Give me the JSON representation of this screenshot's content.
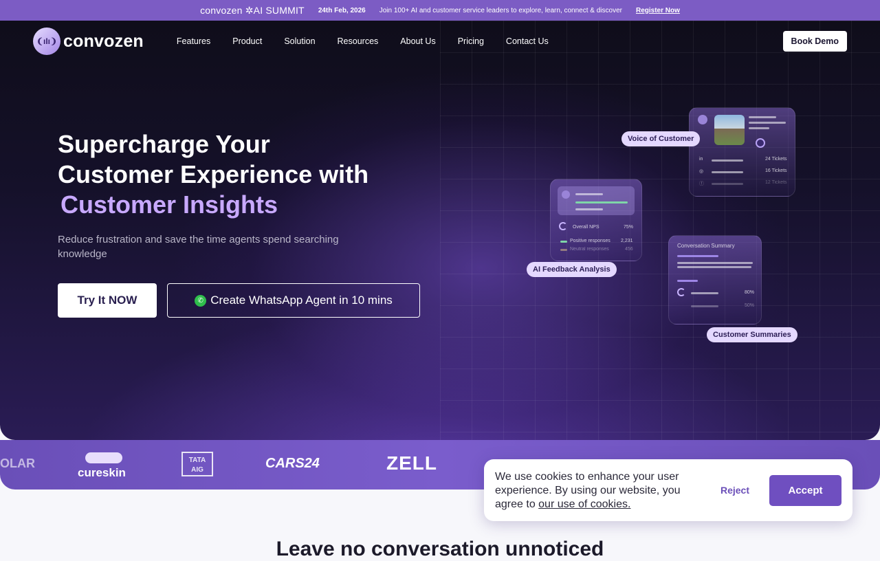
{
  "banner": {
    "brand": "convozen",
    "event": "AI SUMMIT",
    "date": "24th Feb, 2026",
    "text": "Join 100+ AI and customer service leaders to explore, learn, connect & discover",
    "link": "Register Now"
  },
  "nav": {
    "logo_text": "convozen",
    "items": [
      "Features",
      "Product",
      "Solution",
      "Resources",
      "About Us",
      "Pricing",
      "Contact Us"
    ],
    "cta": "Book Demo"
  },
  "hero": {
    "line1": "Supercharge Your",
    "line2": "Customer Experience with",
    "accent": "Customer Insights",
    "subtitle": "Reduce frustration and save the time agents spend searching knowledge",
    "cta_primary": "Try It NOW",
    "cta_secondary": "Create WhatsApp Agent in 10 mins"
  },
  "cards": {
    "voc_label": "Voice of Customer",
    "voc_rows": [
      "24 Tickets",
      "16 Tickets",
      "12 Tickets"
    ],
    "feedback_label": "AI Feedback Analysis",
    "feedback_nps": "Overall NPS",
    "feedback_nps_value": "75%",
    "feedback_pos": "Positive responses",
    "feedback_pos_value": "2,231",
    "feedback_neu": "Neutral responses",
    "feedback_neu_value": "456",
    "summary_title": "Conversation Summary",
    "summary_v1": "80%",
    "summary_v2": "50%",
    "summary_label": "Customer Summaries"
  },
  "clients": [
    "OLAR",
    "cureskin",
    "TATA AIG",
    "CARS24",
    "ZELL"
  ],
  "next_section_title": "Leave no conversation unnoticed",
  "cookie": {
    "text": "We use cookies to enhance your user experience. By using our website, you agree to ",
    "link": "our use of cookies.",
    "reject": "Reject",
    "accept": "Accept"
  }
}
